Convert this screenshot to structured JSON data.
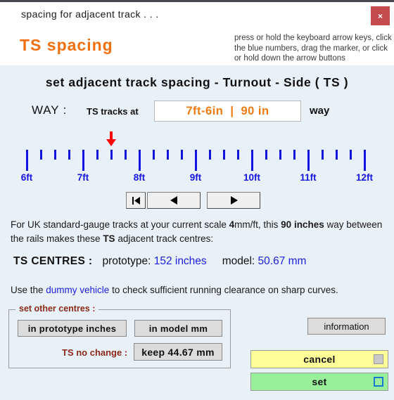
{
  "window": {
    "title": "spacing  for  adjacent  track . . .",
    "close_label": "×"
  },
  "header": {
    "brand": "TS  spacing",
    "hint": "press or hold the keyboard arrow keys, click the blue numbers, drag the marker, or click or hold down the arrow buttons"
  },
  "main": {
    "heading": "set  adjacent  track  spacing  -  Turnout - Side  ( TS )",
    "way_label": "WAY :",
    "way_sub": "TS tracks at",
    "value_feet": "7ft-6in",
    "value_sep": "|",
    "value_inches": "90 in",
    "way_tail": "way"
  },
  "ruler": {
    "marker_value": "7ft-6in",
    "marker_position_ft": 7.5,
    "min_ft": 6,
    "max_ft": 12,
    "minor_per_major": 4,
    "labels": [
      "6ft",
      "7ft",
      "8ft",
      "9ft",
      "10ft",
      "11ft",
      "12ft"
    ],
    "tick_color": "#1414e0",
    "marker_color": "#ff0000"
  },
  "nav": {
    "first_label": "◀❘",
    "prev_label": "◀",
    "next_label": "▶"
  },
  "info": {
    "para1_a": "For UK standard-gauge tracks at your current scale ",
    "para1_scale": "4",
    "para1_b": "mm/ft, this ",
    "para1_inches": "90 inches",
    "para1_c": " way between the rails makes these ",
    "para1_ts": "TS",
    "para1_d": " adjacent track centres:",
    "centres_key": "TS CENTRES :",
    "prototype_label": "prototype:",
    "prototype_value": "152 inches",
    "model_label": "model:",
    "model_value": "50.67 mm",
    "para2_a": "Use the ",
    "para2_link": "dummy vehicle",
    "para2_b": " to check sufficient running clearance on sharp curves."
  },
  "group": {
    "legend": "set other centres :",
    "prototype_btn": "in  prototype  inches",
    "model_btn": "in  model  mm",
    "nochange_label": "TS no change :",
    "keep_btn": "keep  44.67 mm"
  },
  "actions": {
    "information": "information",
    "cancel": "cancel",
    "set": "set"
  }
}
